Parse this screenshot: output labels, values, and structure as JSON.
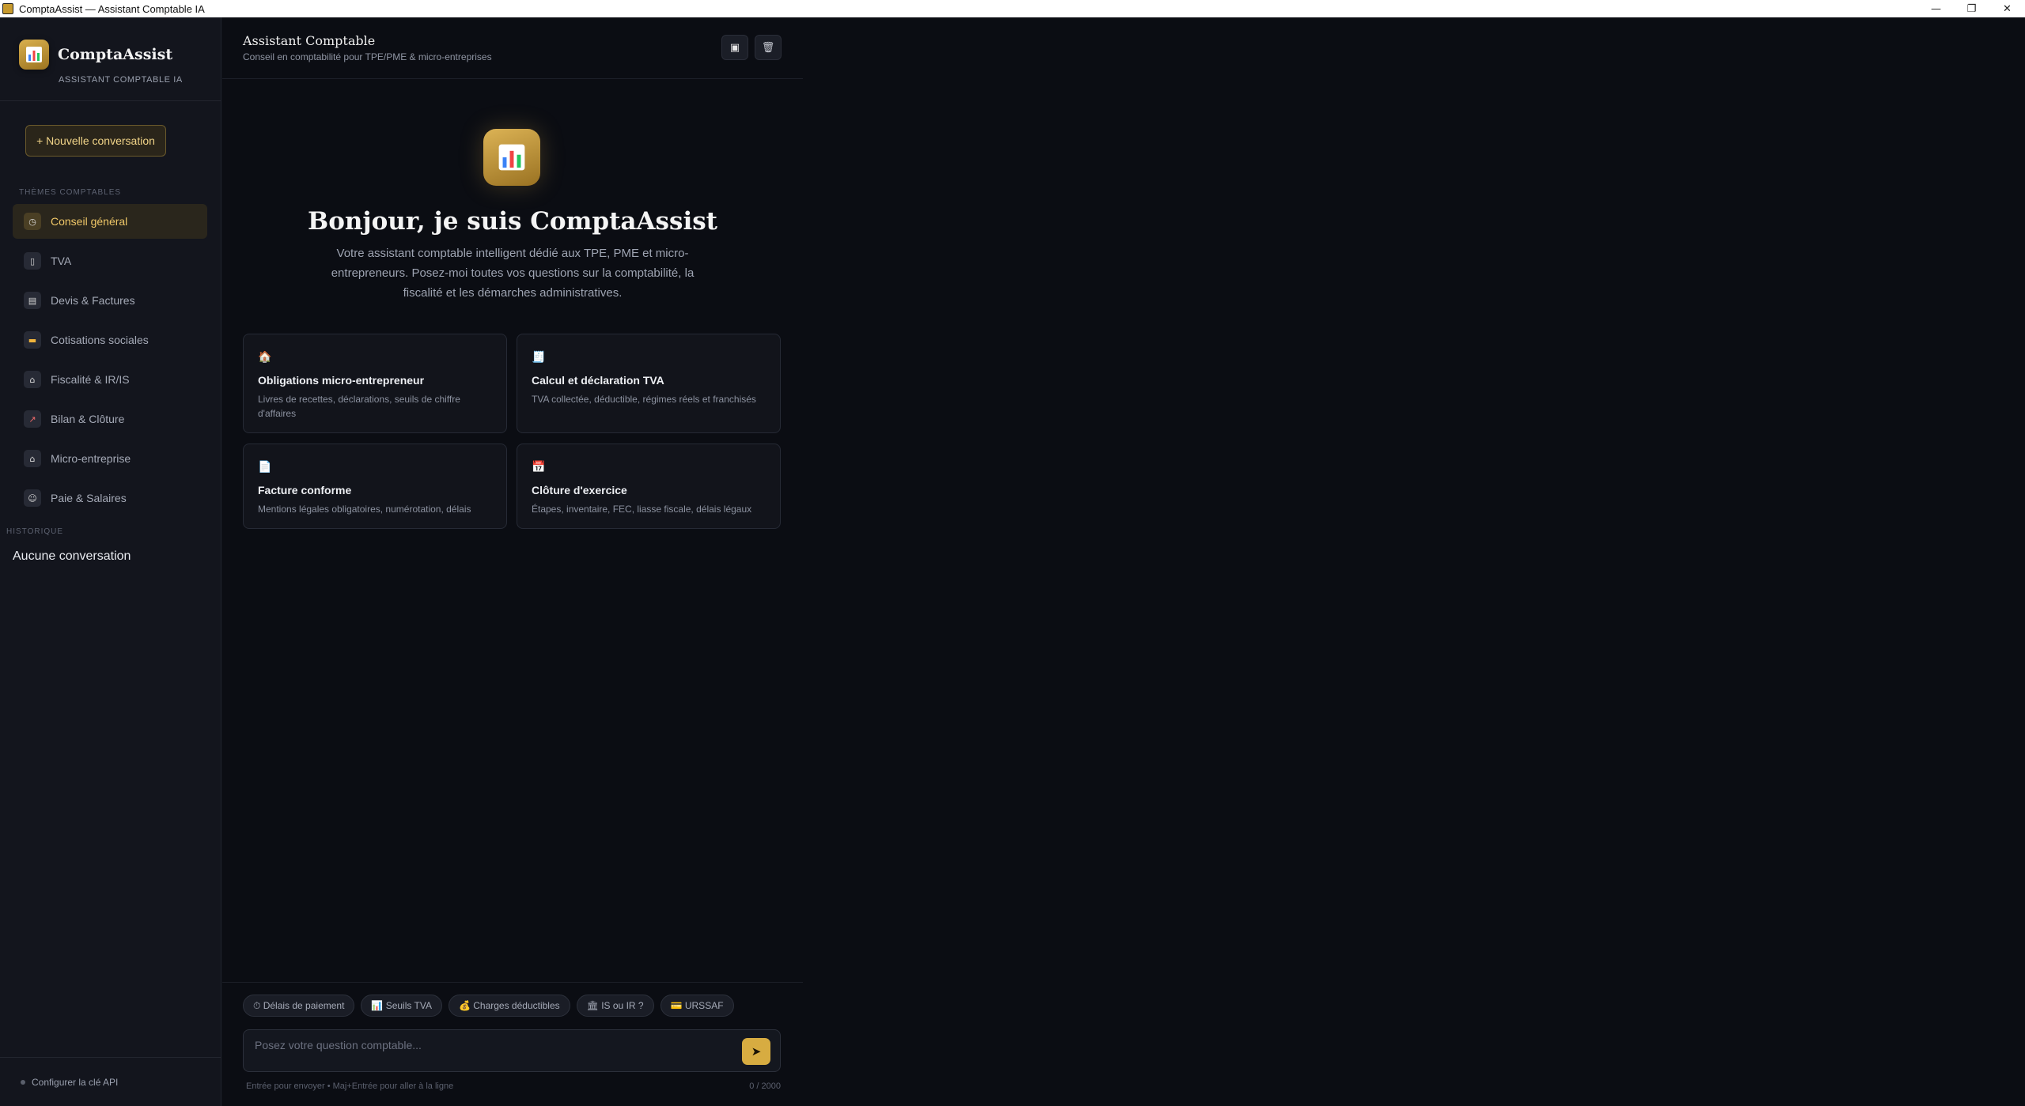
{
  "window": {
    "title": "ComptaAssist — Assistant Comptable IA",
    "controls": {
      "minimize": "—",
      "maximize": "❐",
      "close": "✕"
    }
  },
  "sidebar": {
    "brand_name": "ComptaAssist",
    "brand_subtitle": "ASSISTANT COMPTABLE IA",
    "new_conversation": "+ Nouvelle conversation",
    "themes_title": "THÈMES COMPTABLES",
    "items": [
      {
        "label": "Conseil général",
        "icon": "compass-icon",
        "active": true
      },
      {
        "label": "TVA",
        "icon": "receipt-icon",
        "active": false
      },
      {
        "label": "Devis & Factures",
        "icon": "document-icon",
        "active": false
      },
      {
        "label": "Cotisations sociales",
        "icon": "credit-card-icon",
        "active": false
      },
      {
        "label": "Fiscalité & IR/IS",
        "icon": "bank-icon",
        "active": false
      },
      {
        "label": "Bilan & Clôture",
        "icon": "chart-up-icon",
        "active": false
      },
      {
        "label": "Micro-entreprise",
        "icon": "house-icon",
        "active": false
      },
      {
        "label": "Paie & Salaires",
        "icon": "id-card-icon",
        "active": false
      }
    ],
    "history_title": "HISTORIQUE",
    "no_conversation": "Aucune conversation",
    "api_link": "Configurer la clé API"
  },
  "header": {
    "title": "Assistant Comptable",
    "subtitle": "Conseil en comptabilité pour TPE/PME & micro-entreprises"
  },
  "welcome": {
    "title": "Bonjour, je suis ComptaAssist",
    "text": "Votre assistant comptable intelligent dédié aux TPE, PME et micro-entrepreneurs. Posez-moi toutes vos questions sur la comptabilité, la fiscalité et les démarches administratives."
  },
  "cards": [
    {
      "icon": "house-icon",
      "title": "Obligations micro-entrepreneur",
      "desc": "Livres de recettes, déclarations, seuils de chiffre d'affaires"
    },
    {
      "icon": "receipt-icon",
      "title": "Calcul et déclaration TVA",
      "desc": "TVA collectée, déductible, régimes réels et franchisés"
    },
    {
      "icon": "document-icon",
      "title": "Facture conforme",
      "desc": "Mentions légales obligatoires, numérotation, délais"
    },
    {
      "icon": "calendar-icon",
      "title": "Clôture d'exercice",
      "desc": "Étapes, inventaire, FEC, liasse fiscale, délais légaux"
    }
  ],
  "chips": [
    "⏱ Délais de paiement",
    "📊 Seuils TVA",
    "💰 Charges déductibles",
    "🏛 IS ou IR ?",
    "💳 URSSAF"
  ],
  "input": {
    "placeholder": "Posez votre question comptable...",
    "hint": "Entrée pour envoyer • Maj+Entrée pour aller à la ligne",
    "counter": "0 / 2000"
  },
  "colors": {
    "accent": "#d7ac41",
    "background": "#0b0d13",
    "sidebar": "#13151d"
  }
}
